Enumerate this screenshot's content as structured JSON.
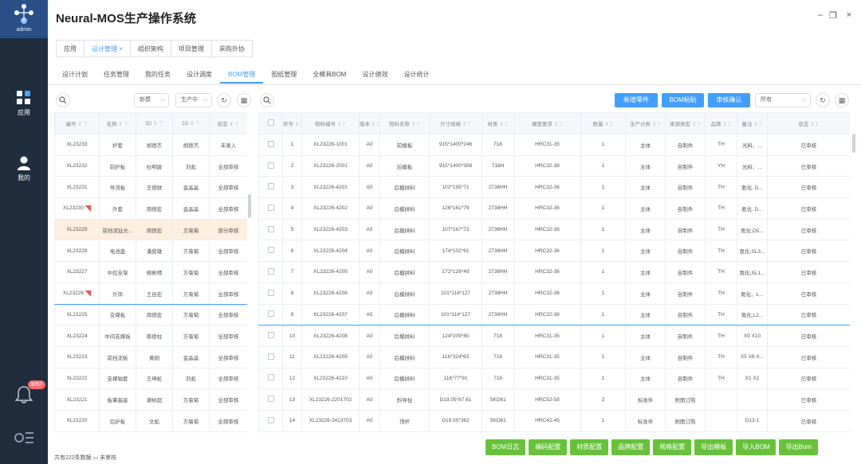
{
  "rail": {
    "logo_label": "admin",
    "items": [
      {
        "label": "应用"
      },
      {
        "label": "我的"
      }
    ],
    "notif_count": "3057"
  },
  "window": {
    "title": "Neural-MOS生产操作系统",
    "min": "–",
    "restore": "❐",
    "close": "×"
  },
  "tabs": [
    {
      "label": "应用",
      "active": false
    },
    {
      "label": "设计管理",
      "active": true,
      "closable": "×"
    },
    {
      "label": "组织架构",
      "active": false
    },
    {
      "label": "项目管理",
      "active": false
    },
    {
      "label": "采购外协",
      "active": false
    }
  ],
  "subtabs": [
    "设计计划",
    "任务管理",
    "我的任务",
    "设计调度",
    "BOM管理",
    "图纸管理",
    "全模具BOM",
    "设计绩效",
    "设计统计"
  ],
  "subtab_active": 4,
  "left": {
    "filter1": "新模",
    "filter2": "生产中",
    "headers": [
      "编号",
      "名称",
      "3D",
      "2D",
      "状态"
    ],
    "rows": [
      [
        "XL23233",
        "护套",
        "胡德杰",
        "胡德杰",
        "未录入"
      ],
      [
        "XL23232",
        "前护板",
        "杜明骏",
        "刘彪",
        "全部审核"
      ],
      [
        "XL23231",
        "导流板",
        "王德财",
        "金晶晶",
        "全部审核"
      ],
      [
        "XL23230",
        "外套",
        "周德宏",
        "金晶晶",
        "全部审核"
      ],
      [
        "XL23229",
        "前挡泥延长...",
        "周德宏",
        "方菊菊",
        "部分审核"
      ],
      [
        "XL23228",
        "电池盖",
        "潘俊雄",
        "方菊菊",
        "全部审核"
      ],
      [
        "XL23227",
        "中控支架",
        "柳彬晴",
        "方菊菊",
        "全部审核"
      ],
      [
        "XL23226",
        "外饰",
        "王自宏",
        "方菊菊",
        "全部审核"
      ],
      [
        "XL23225",
        "支撑板",
        "周德宏",
        "方菊菊",
        "全部审核"
      ],
      [
        "XL23224",
        "中间支撑板",
        "蔡德柱",
        "方菊菊",
        "全部审核"
      ],
      [
        "XL23223",
        "前挡泥板",
        "黄刚",
        "金晶晶",
        "全部审核"
      ],
      [
        "XL23222",
        "支撑轴套",
        "王坤彪",
        "刘彪",
        "全部审核"
      ],
      [
        "XL23221",
        "板簧基座",
        "谢树超",
        "方菊菊",
        "全部审核"
      ],
      [
        "XL23220",
        "后护板",
        "文彪",
        "方菊菊",
        "全部审核"
      ]
    ],
    "footer": "共有222条数据 ▭ 未审核"
  },
  "right": {
    "buttons": [
      "新增零件",
      "BOM粘贴",
      "审核确认"
    ],
    "filter": "所有",
    "headers": [
      "序号",
      "物料编号",
      "版本",
      "物料名称",
      "尺寸规格",
      "材质",
      "硬度要求",
      "数量",
      "生产分类",
      "来源类型",
      "品牌",
      "备注",
      "状态"
    ],
    "rows": [
      [
        "1",
        "XL23226-1001",
        "A0",
        "前模板",
        "915*1400*246",
        "718",
        "HRC31-35",
        "1",
        "主体",
        "自制件",
        "TH",
        "光料、...",
        "已审核"
      ],
      [
        "2",
        "XL23226-2001",
        "A0",
        "后模板",
        "915*1400*308",
        "718H",
        "HRC32-38",
        "1",
        "主体",
        "自制件",
        "YH",
        "光料、...",
        "已审核"
      ],
      [
        "3",
        "XL23226-4201",
        "A0",
        "后模拼料",
        "102*195*71",
        "2738HH",
        "HRC32-36",
        "1",
        "主体",
        "自制件",
        "TH",
        "氮化, D...",
        "已审核"
      ],
      [
        "4",
        "XL23226-4202",
        "A0",
        "后模拼料",
        "126*161*79",
        "2738HH",
        "HRC32-36",
        "1",
        "主体",
        "自制件",
        "TH",
        "氮化, D...",
        "已审核"
      ],
      [
        "5",
        "XL23226-4203",
        "A0",
        "后模拼料",
        "107*167*72",
        "2738HH",
        "HRC32-36",
        "1",
        "主体",
        "自制件",
        "TH",
        "氮化,D5...",
        "已审核"
      ],
      [
        "6",
        "XL23226-4204",
        "A0",
        "后模拼料",
        "174*102*61",
        "2738HH",
        "HRC32-36",
        "1",
        "主体",
        "自制件",
        "TH",
        "氮化,SL3...",
        "已审核"
      ],
      [
        "7",
        "XL23226-4205",
        "A0",
        "后模拼料",
        "172*126*49",
        "2738HH",
        "HRC32-36",
        "1",
        "主体",
        "自制件",
        "TH",
        "氮化,SL1...",
        "已审核"
      ],
      [
        "8",
        "XL23226-4206",
        "A0",
        "后模拼料",
        "101*114*127",
        "2738HH",
        "HRC32-36",
        "1",
        "主体",
        "自制件",
        "TH",
        "氮化、L...",
        "已审核"
      ],
      [
        "9",
        "XL23226-4207",
        "A0",
        "后模拼料",
        "101*114*127",
        "2738HH",
        "HRC32-36",
        "1",
        "主体",
        "自制件",
        "TH",
        "氮化,L2...",
        "已审核"
      ],
      [
        "10",
        "XL23226-4208",
        "A0",
        "后模拼料",
        "124*209*80",
        "718",
        "HRC31-35",
        "1",
        "主体",
        "自制件",
        "TH",
        "X9 X10",
        "已审核"
      ],
      [
        "11",
        "XL23226-4209",
        "A0",
        "后模拼料",
        "116*324*63",
        "718",
        "HRC31-35",
        "1",
        "主体",
        "自制件",
        "TH",
        "X5 X6 X...",
        "已审核"
      ],
      [
        "12",
        "XL23226-4210",
        "A0",
        "后模拼料",
        "116*77*91",
        "718",
        "HRC31-35",
        "1",
        "主体",
        "自制件",
        "TH",
        "X1 X2",
        "已审核"
      ],
      [
        "13",
        "XL23226-2201702",
        "A0",
        "斜导柱",
        "D19.05*87.61",
        "SKD61",
        "HRC52-58",
        "2",
        "标准件",
        "附图订购",
        "",
        "",
        "已审核"
      ],
      [
        "14",
        "XL23226-2413703",
        "A0",
        "顶杆",
        "D19.05*362",
        "SKD61",
        "HRC42-45",
        "1",
        "标准件",
        "附图订购",
        "",
        "D13-1",
        "已审核"
      ]
    ],
    "bottom_buttons": [
      "BOM日志",
      "编码配置",
      "材质配置",
      "品牌配置",
      "规格配置",
      "导出模板",
      "导入BOM",
      "导出Bom"
    ]
  },
  "colors": {
    "accent": "#409eff",
    "green": "#67c23a",
    "rail": "#1f2d3d",
    "selected_row": "#fcefdf"
  }
}
